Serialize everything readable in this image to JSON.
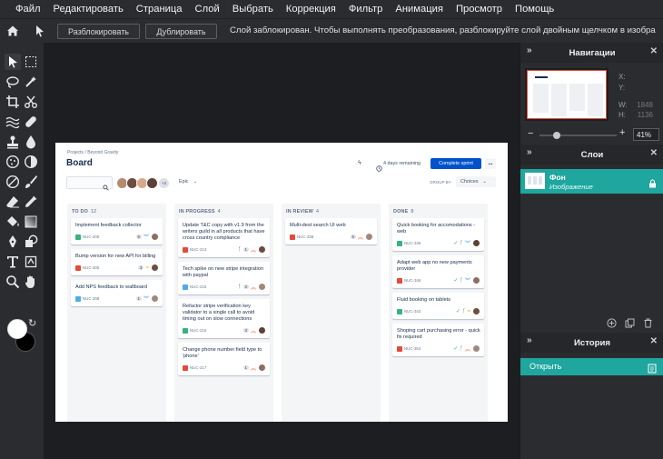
{
  "menu": [
    "Файл",
    "Редактировать",
    "Страница",
    "Слой",
    "Выбрать",
    "Коррекция",
    "Фильтр",
    "Анимация",
    "Просмотр",
    "Помощь"
  ],
  "options": {
    "unlock_label": "Разблокировать",
    "duplicate_label": "Дублировать",
    "lock_message": "Слой заблокирован. Чтобы выполнять преобразования, разблокируйте слой двойным щелчком в изобра"
  },
  "navigation": {
    "title": "Навигации",
    "x_label": "X:",
    "y_label": "Y:",
    "w_label": "W:",
    "w_value": "1848",
    "h_label": "H:",
    "h_value": "1136",
    "zoom": "41%",
    "zoom_fraction": 0.22
  },
  "layers": {
    "title": "Слои",
    "items": [
      {
        "name": "Фон",
        "subtitle": "Изображение"
      }
    ]
  },
  "history": {
    "title": "История",
    "items": [
      {
        "label": "Открыть"
      }
    ]
  },
  "board": {
    "breadcrumb": "Projects / Beyond Gravity",
    "title": "Board",
    "remaining": "4 days remaining",
    "complete_label": "Complete sprint",
    "more_label": "•••",
    "avatar_extra": "+3",
    "epic_label": "Epic",
    "groupby_label": "GROUP BY",
    "groupby_value": "Choices",
    "columns": [
      {
        "title": "TO DO",
        "count": "12",
        "cards": [
          {
            "title": "Implement feedback collector",
            "key": "NUC-205",
            "type": "story",
            "est": "9",
            "pri": "low"
          },
          {
            "title": "Bump version for new API for billing",
            "key": "NUC-206",
            "type": "bug",
            "est": "3",
            "pri": "med"
          },
          {
            "title": "Add NPS feedback to wallboard",
            "key": "NUC-208",
            "type": "task",
            "est": "1",
            "pri": "low"
          }
        ]
      },
      {
        "title": "IN PROGRESS",
        "count": "4",
        "cards": [
          {
            "title": "Update T&C copy with v1.9 from the writers guild in all products that have cross country compliance",
            "key": "NUC-213",
            "type": "bug",
            "est": "1",
            "pri": "high"
          },
          {
            "title": "Tech spike on new stripe integration with paypal",
            "key": "NUC-215",
            "type": "task",
            "est": "3",
            "pri": "high"
          },
          {
            "title": "Refactor stripe verification key validator to a single call to avoid timing out on slow connections",
            "key": "NUC-216",
            "type": "story",
            "est": "3",
            "pri": "high"
          },
          {
            "title": "Change phone number field type to 'phone'",
            "key": "NUC-217",
            "type": "bug",
            "est": "1",
            "pri": "high"
          }
        ]
      },
      {
        "title": "IN REVIEW",
        "count": "4",
        "cards": [
          {
            "title": "Multi-dest search UI web",
            "key": "NUC-338",
            "type": "bug",
            "est": "5",
            "pri": "high"
          }
        ]
      },
      {
        "title": "DONE",
        "count": "8",
        "cards": [
          {
            "title": "Quick booking for accomodations - web",
            "key": "NUC-336",
            "type": "story",
            "est": "",
            "pri": "low"
          },
          {
            "title": "Adapt web app no new payments provider",
            "key": "NUC-346",
            "type": "bug",
            "est": "",
            "pri": "low"
          },
          {
            "title": "Fluid booking on tablets",
            "key": "NUC-343",
            "type": "story",
            "est": "",
            "pri": "med"
          },
          {
            "title": "Shoping cart purchasing error - quick fix required",
            "key": "NUC-354",
            "type": "bug",
            "est": "",
            "pri": "high"
          }
        ]
      }
    ]
  },
  "colors": {
    "accent": "#1fa69e",
    "jira_blue": "#0052cc",
    "story": "#36b37e",
    "bug": "#e5493a",
    "task": "#4bade8"
  }
}
